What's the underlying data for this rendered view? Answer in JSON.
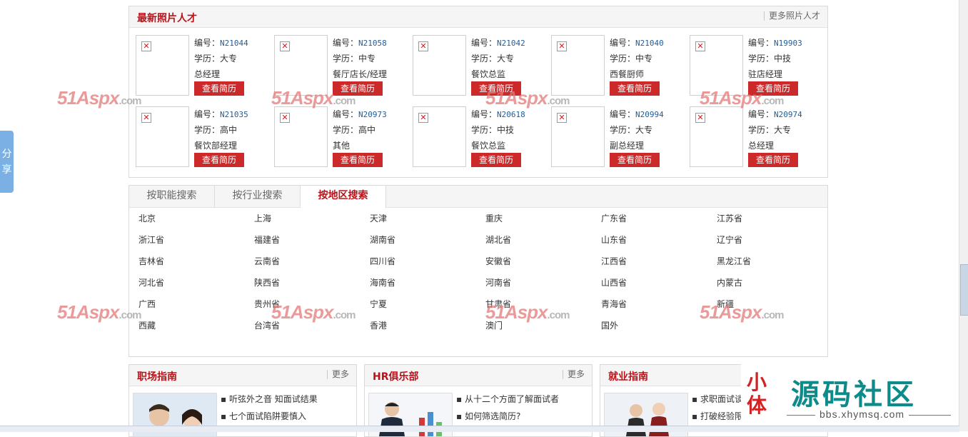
{
  "share_tab": "分享",
  "photo_talent": {
    "title": "最新照片人才",
    "more": "更多照片人才",
    "code_label": "编号：",
    "edu_label": "学历：",
    "button": "查看简历",
    "cards": [
      {
        "code": "N21044",
        "edu": "大专",
        "position": "总经理"
      },
      {
        "code": "N21058",
        "edu": "中专",
        "position": "餐厅店长/经理"
      },
      {
        "code": "N21042",
        "edu": "大专",
        "position": "餐饮总监"
      },
      {
        "code": "N21040",
        "edu": "中专",
        "position": "西餐厨师"
      },
      {
        "code": "N19903",
        "edu": "中技",
        "position": "驻店经理"
      },
      {
        "code": "N21035",
        "edu": "高中",
        "position": "餐饮部经理"
      },
      {
        "code": "N20973",
        "edu": "高中",
        "position": "其他"
      },
      {
        "code": "N20618",
        "edu": "中技",
        "position": "餐饮总监"
      },
      {
        "code": "N20994",
        "edu": "大专",
        "position": "副总经理"
      },
      {
        "code": "N20974",
        "edu": "大专",
        "position": "总经理"
      }
    ]
  },
  "search_tabs": [
    "按职能搜索",
    "按行业搜索",
    "按地区搜索"
  ],
  "active_tab": 2,
  "regions": [
    "北京",
    "上海",
    "天津",
    "重庆",
    "广东省",
    "江苏省",
    "浙江省",
    "福建省",
    "湖南省",
    "湖北省",
    "山东省",
    "辽宁省",
    "吉林省",
    "云南省",
    "四川省",
    "安徽省",
    "江西省",
    "黑龙江省",
    "河北省",
    "陕西省",
    "海南省",
    "河南省",
    "山西省",
    "内蒙古",
    "广西",
    "贵州省",
    "宁夏",
    "甘肃省",
    "青海省",
    "新疆",
    "西藏",
    "台湾省",
    "香港",
    "澳门",
    "国外"
  ],
  "news_columns": [
    {
      "title": "职场指南",
      "more": "更多",
      "items": [
        "听弦外之音 知面试结果",
        "七个面试陷阱要慎入"
      ]
    },
    {
      "title": "HR俱乐部",
      "more": "更多",
      "items": [
        "从十二个方面了解面试者",
        "如何筛选简历?"
      ]
    },
    {
      "title": "就业指南",
      "more": "",
      "items": [
        "求职面试谈",
        "打破经验限"
      ]
    }
  ],
  "watermark": {
    "brand": "51Aspx",
    "suffix": ".com"
  },
  "site_brand": {
    "name": "源码社区",
    "url": "bbs.xhymsq.com",
    "logo": "小体"
  },
  "colors": {
    "accent": "#b8131a",
    "button": "#cc2a2a",
    "code": "#1f5c99"
  }
}
